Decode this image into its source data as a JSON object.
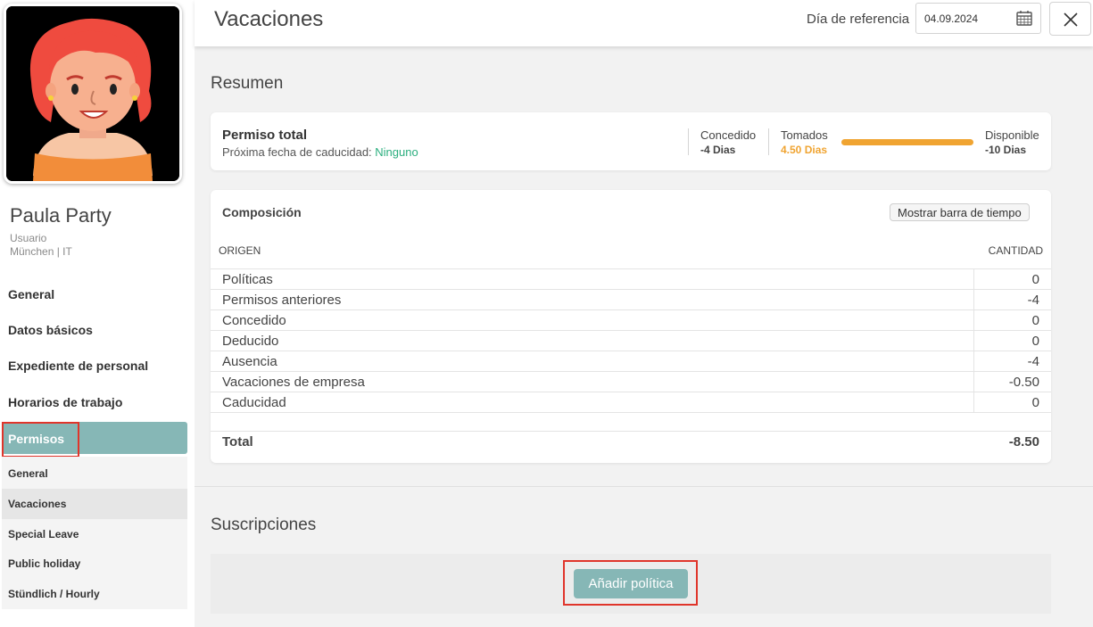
{
  "user": {
    "name": "Paula Party",
    "role": "Usuario",
    "location": "München | IT"
  },
  "nav": {
    "items": [
      "General",
      "Datos básicos",
      "Expediente de personal",
      "Horarios de trabajo"
    ],
    "active": "Permisos",
    "sub_items": [
      "General",
      "Vacaciones",
      "Special Leave",
      "Public holiday",
      "Stündlich / Hourly"
    ],
    "selected_sub": "Vacaciones"
  },
  "header": {
    "title": "Vacaciones",
    "ref_label": "Día de referencia",
    "ref_date": "04.09.2024"
  },
  "summary": {
    "section_title": "Resumen",
    "title": "Permiso total",
    "expiry_label": "Próxima fecha de caducidad:",
    "expiry_value": "Ninguno",
    "granted_label": "Concedido",
    "granted_value": "-4 Dias",
    "taken_label": "Tomados",
    "taken_value": "4.50 Dias",
    "available_label": "Disponible",
    "available_value": "-10 Dias"
  },
  "composition": {
    "title": "Composición",
    "timeline_button": "Mostrar barra de tiempo",
    "col_origin": "ORIGEN",
    "col_amount": "CANTIDAD",
    "rows": [
      {
        "origin": "Políticas",
        "amount": "0"
      },
      {
        "origin": "Permisos anteriores",
        "amount": "-4"
      },
      {
        "origin": "Concedido",
        "amount": "0"
      },
      {
        "origin": "Deducido",
        "amount": "0"
      },
      {
        "origin": "Ausencia",
        "amount": "-4"
      },
      {
        "origin": "Vacaciones de empresa",
        "amount": "-0.50"
      },
      {
        "origin": "Caducidad",
        "amount": "0"
      }
    ],
    "total_label": "Total",
    "total_value": "-8.50"
  },
  "subscriptions": {
    "section_title": "Suscripciones",
    "add_button": "Añadir política"
  },
  "colors": {
    "accent": "#86b7b6",
    "taken": "#f0a431",
    "highlight": "#e0352b",
    "expiry": "#2bae7e"
  }
}
